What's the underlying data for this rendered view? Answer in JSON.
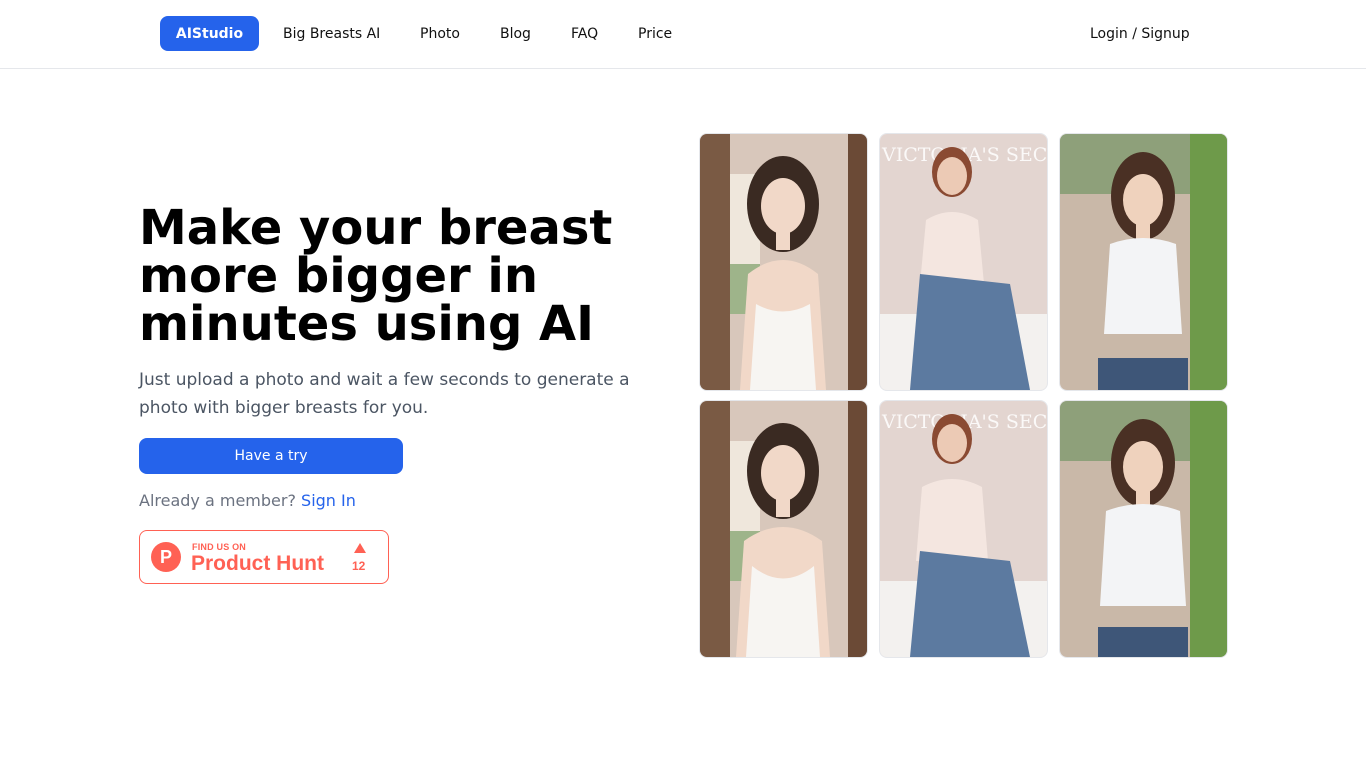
{
  "header": {
    "logo_label": "AIStudio",
    "nav": [
      "Big Breasts AI",
      "Photo",
      "Blog",
      "FAQ",
      "Price"
    ],
    "login_label": "Login / Signup"
  },
  "hero": {
    "headline_lines": [
      "Make your breast",
      "more bigger in",
      "minutes using AI"
    ],
    "subtext": "Just upload a photo and wait a few seconds to generate a photo with bigger breasts for you.",
    "cta_label": "Have a try",
    "member_text": "Already a member?",
    "signin_label": "Sign In"
  },
  "product_hunt": {
    "logo_letter": "P",
    "find_text": "FIND US ON",
    "name": "Product Hunt",
    "upvotes": "12"
  },
  "gallery": {
    "watermark_text": "VICTORIA'S SECR",
    "photos": [
      {
        "name": "photo-room-original",
        "watermark": false
      },
      {
        "name": "photo-victorias-original",
        "watermark": true
      },
      {
        "name": "photo-garden-original",
        "watermark": false
      },
      {
        "name": "photo-room-result",
        "watermark": false
      },
      {
        "name": "photo-victorias-result",
        "watermark": true
      },
      {
        "name": "photo-garden-result",
        "watermark": false
      }
    ]
  },
  "colors": {
    "accent": "#2563eb",
    "product_hunt": "#ff6154",
    "muted_text": "#4b5563"
  }
}
